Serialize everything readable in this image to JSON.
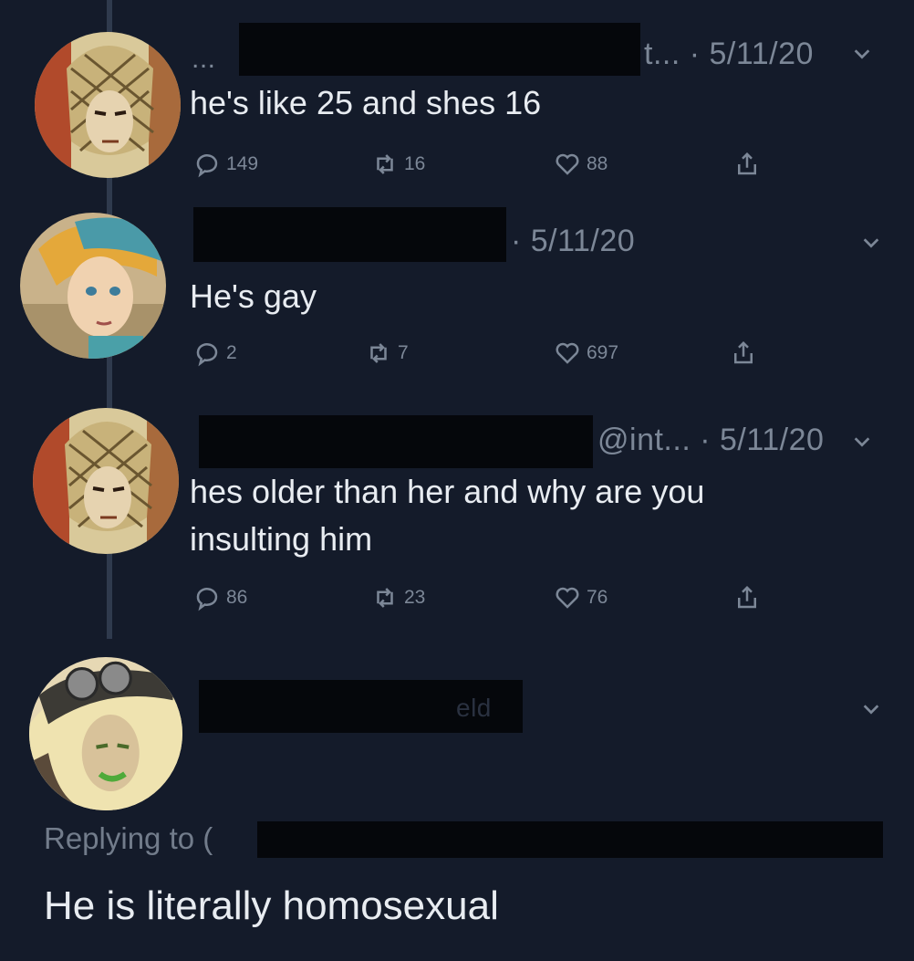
{
  "tweets": [
    {
      "meta": "t... · 5/11/20",
      "prefix": "...",
      "text": "he's like 25 and shes 16",
      "replies": "149",
      "retweets": "16",
      "likes": "88"
    },
    {
      "meta": "· 5/11/20",
      "text": "He's gay",
      "replies": "2",
      "retweets": "7",
      "likes": "697"
    },
    {
      "meta": "@int... · 5/11/20",
      "text": "hes older than her and why are you insulting him",
      "replies": "86",
      "retweets": "23",
      "likes": "76"
    }
  ],
  "main_tweet": {
    "handle_fragment": "eld",
    "replying_to": "Replying to (",
    "text": "He is literally homosexual"
  },
  "colors": {
    "background": "#141b2a",
    "text": "#e8ecf1",
    "muted": "#7c8797",
    "redaction": "#05070b"
  },
  "icons": [
    "reply-icon",
    "retweet-icon",
    "like-icon",
    "share-icon",
    "chevron-down-icon"
  ]
}
